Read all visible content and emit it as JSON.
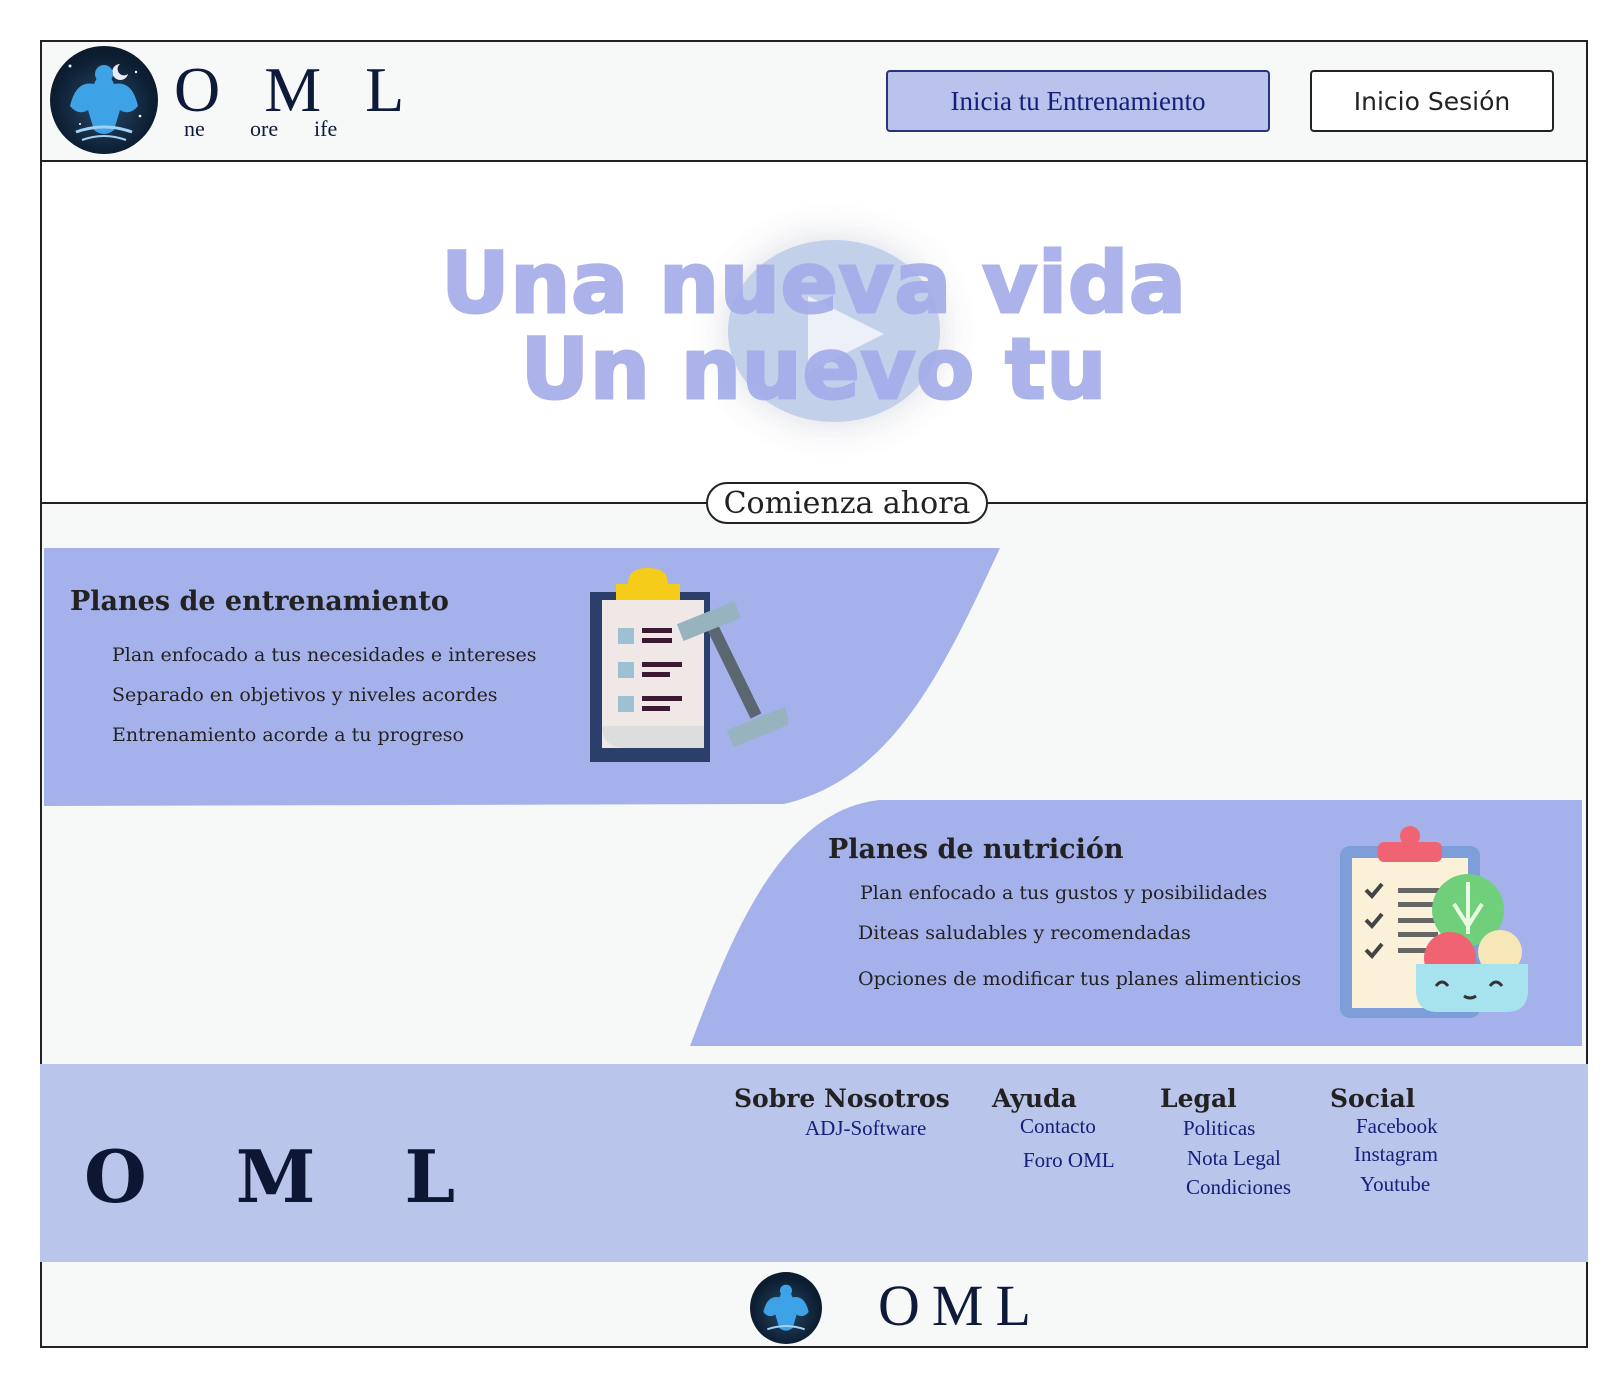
{
  "header": {
    "logo_big": "O M L",
    "logo_small": [
      "ne",
      "ore",
      "ife"
    ],
    "train_button": "Inicia tu Entrenamiento",
    "login_button": "Inicio Sesión"
  },
  "hero": {
    "line1": "Una nueva vida",
    "line2": "Un nuevo tu",
    "cta": "Comienza ahora"
  },
  "training": {
    "title": "Planes de entrenamiento",
    "items": [
      "Plan enfocado a tus necesidades e intereses",
      "Separado en objetivos y niveles acordes",
      "Entrenamiento acorde a tu progreso"
    ]
  },
  "nutrition": {
    "title": "Planes de nutrición",
    "items": [
      "Plan enfocado a tus gustos y posibilidades",
      "Diteas saludables y recomendadas",
      "Opciones de modificar tus planes alimenticios"
    ]
  },
  "footer": {
    "logo": "O M L",
    "columns": [
      {
        "title": "Sobre Nosotros",
        "links": [
          "ADJ-Software"
        ]
      },
      {
        "title": "Ayuda",
        "links": [
          "Contacto",
          "Foro OML"
        ]
      },
      {
        "title": "Legal",
        "links": [
          "Politicas",
          "Nota Legal",
          "Condiciones"
        ]
      },
      {
        "title": "Social",
        "links": [
          "Facebook",
          "Instagram",
          "Youtube"
        ]
      }
    ]
  },
  "bottom": {
    "brand": "OML"
  },
  "colors": {
    "accent": "#a4ade9",
    "footer_bg": "#b9c5ea",
    "button_bg": "#b9c3eb",
    "link": "#15207a"
  }
}
